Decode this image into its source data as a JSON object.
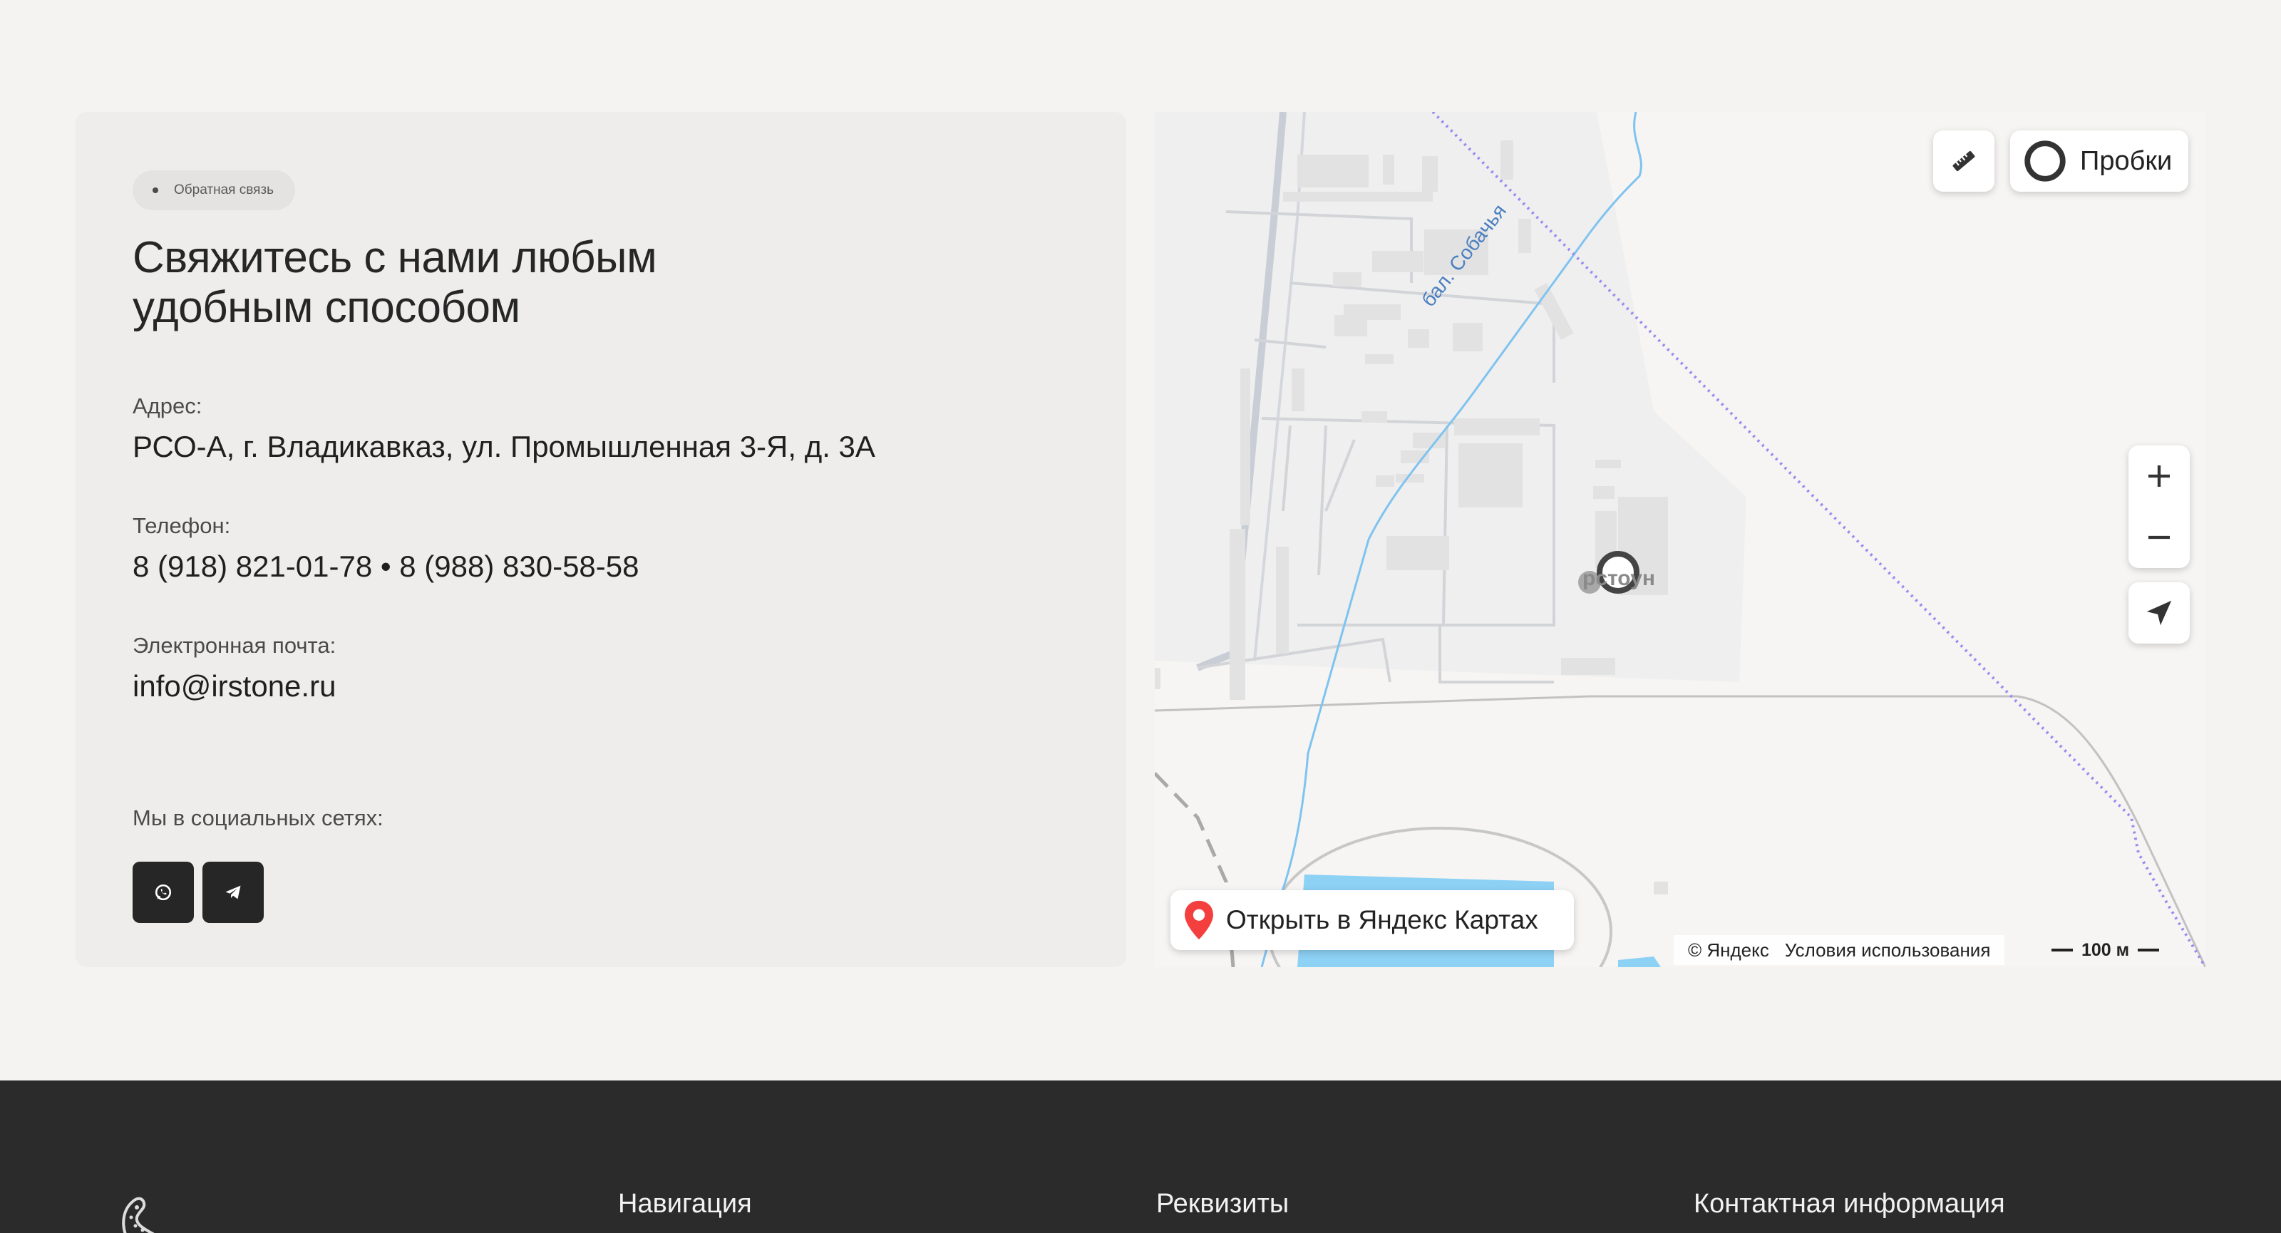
{
  "contact": {
    "badge": "Обратная связь",
    "title_line1": "Свяжитесь с нами любым",
    "title_line2": "удобным способом",
    "address_label": "Адрес:",
    "address_value": "РСО-А, г. Владикавказ, ул. Промышленная 3-Я, д. 3А",
    "phone_label": "Телефон:",
    "phone_value": "8 (918) 821-01-78 • 8 (988) 830-58-58",
    "email_label": "Электронная почта:",
    "email_value": "info@irstone.ru",
    "social_label": "Мы в социальных сетях:",
    "social": [
      {
        "name": "whatsapp",
        "icon": "whatsapp-icon"
      },
      {
        "name": "telegram",
        "icon": "telegram-icon"
      }
    ]
  },
  "map": {
    "traffic_label": "Пробки",
    "open_label": "Открыть в Яндекс Картах",
    "copyright": "© Яндекс",
    "terms": "Условия использования",
    "scale": "100 м",
    "place_label": "рстоун",
    "river_label": "бал. Собачья",
    "colors": {
      "water": "#8dd1f5",
      "river": "#7fc3f0",
      "border": "#9a8cf0",
      "building": "#e2e2e2",
      "zone": "#eeeeee"
    }
  },
  "footer": {
    "nav_heading": "Навигация",
    "requisites_heading": "Реквизиты",
    "contacts_heading": "Контактная информация"
  }
}
